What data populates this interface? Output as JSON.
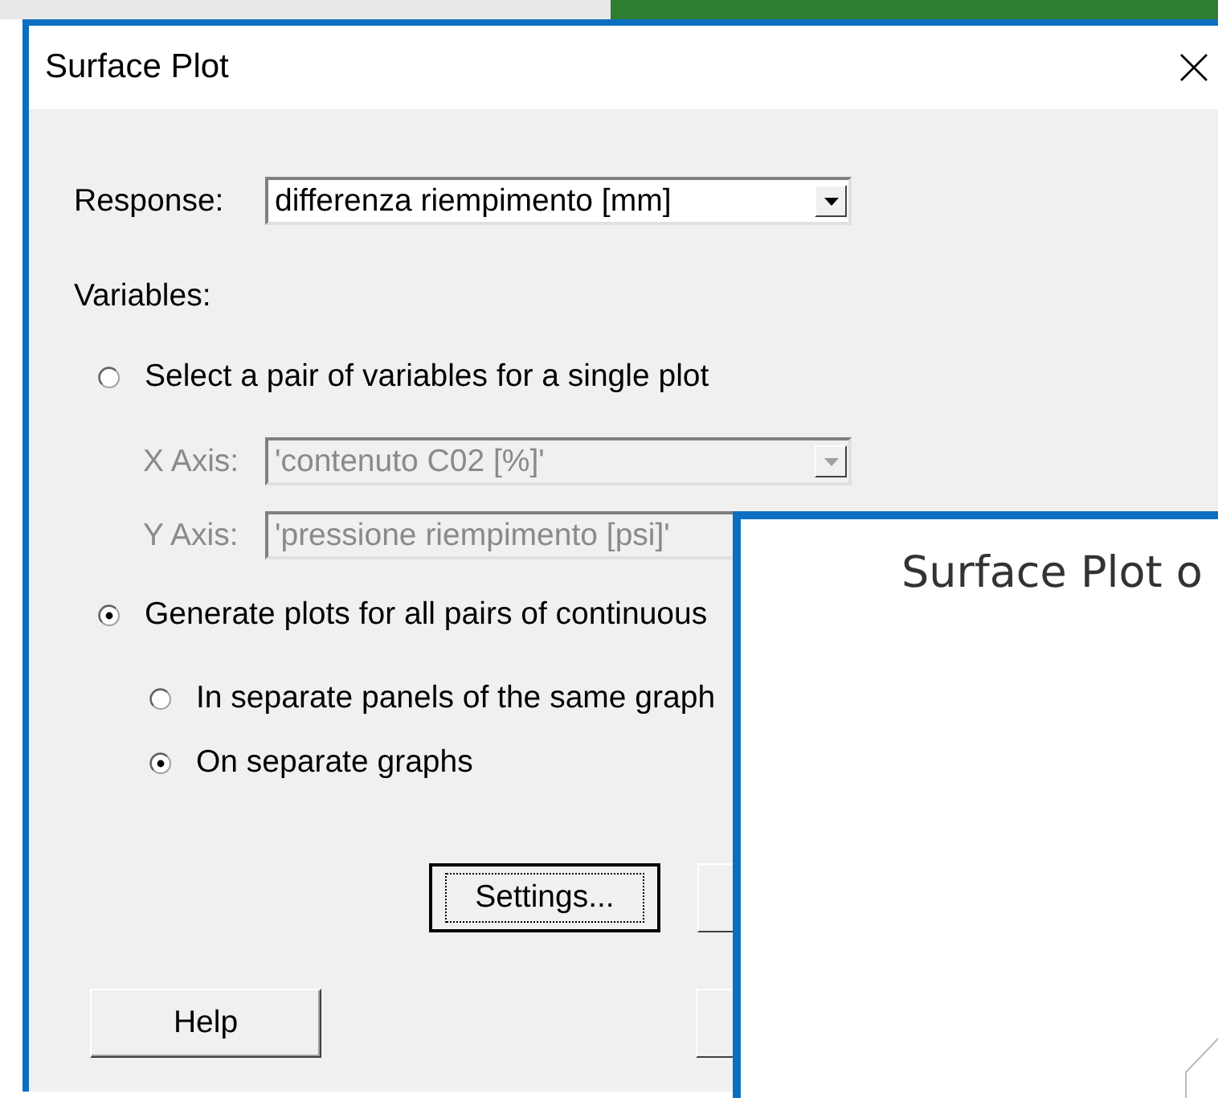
{
  "window": {
    "title": "Surface Plot"
  },
  "response": {
    "label": "Response:",
    "value": "differenza riempimento [mm]",
    "disabled": false
  },
  "variables_label": "Variables:",
  "options": [
    {
      "label": "Select a pair of variables for a single plot",
      "selected": false,
      "fields": [
        {
          "label": "X Axis:",
          "value": "'contenuto C02 [%]'",
          "disabled": true
        },
        {
          "label": "Y Axis:",
          "value": "'pressione riempimento [psi]'",
          "disabled": true
        }
      ]
    },
    {
      "label": "Generate plots for all pairs of continuous",
      "selected": true,
      "sub_options": [
        {
          "label": "In separate panels of the same graph",
          "selected": false
        },
        {
          "label": "On separate graphs",
          "selected": true
        }
      ]
    }
  ],
  "buttons": [
    {
      "label": "Settings...",
      "focused": true
    },
    {
      "label": "Help",
      "focused": false
    }
  ],
  "graph_window": {
    "title": "Surface Plot o"
  }
}
